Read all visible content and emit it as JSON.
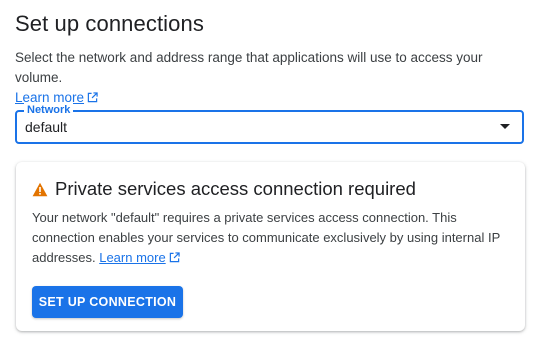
{
  "page": {
    "title": "Set up connections",
    "description": "Select the network and address range that applications will use to access your volume.",
    "learn_more": "Learn more"
  },
  "network_field": {
    "label": "Network",
    "value": "default"
  },
  "card": {
    "title": "Private services access connection required",
    "body": "Your network \"default\" requires a private services access connection. This connection enables your services to communicate exclusively by using internal IP addresses.",
    "learn_more": "Learn more",
    "button_label": "SET UP CONNECTION"
  },
  "colors": {
    "accent": "#1a73e8",
    "warning": "#e37400",
    "text": "#202124"
  },
  "icons": {
    "external_link": "open-in-new-icon",
    "warning": "warning-icon",
    "dropdown": "arrow-drop-down-icon"
  }
}
